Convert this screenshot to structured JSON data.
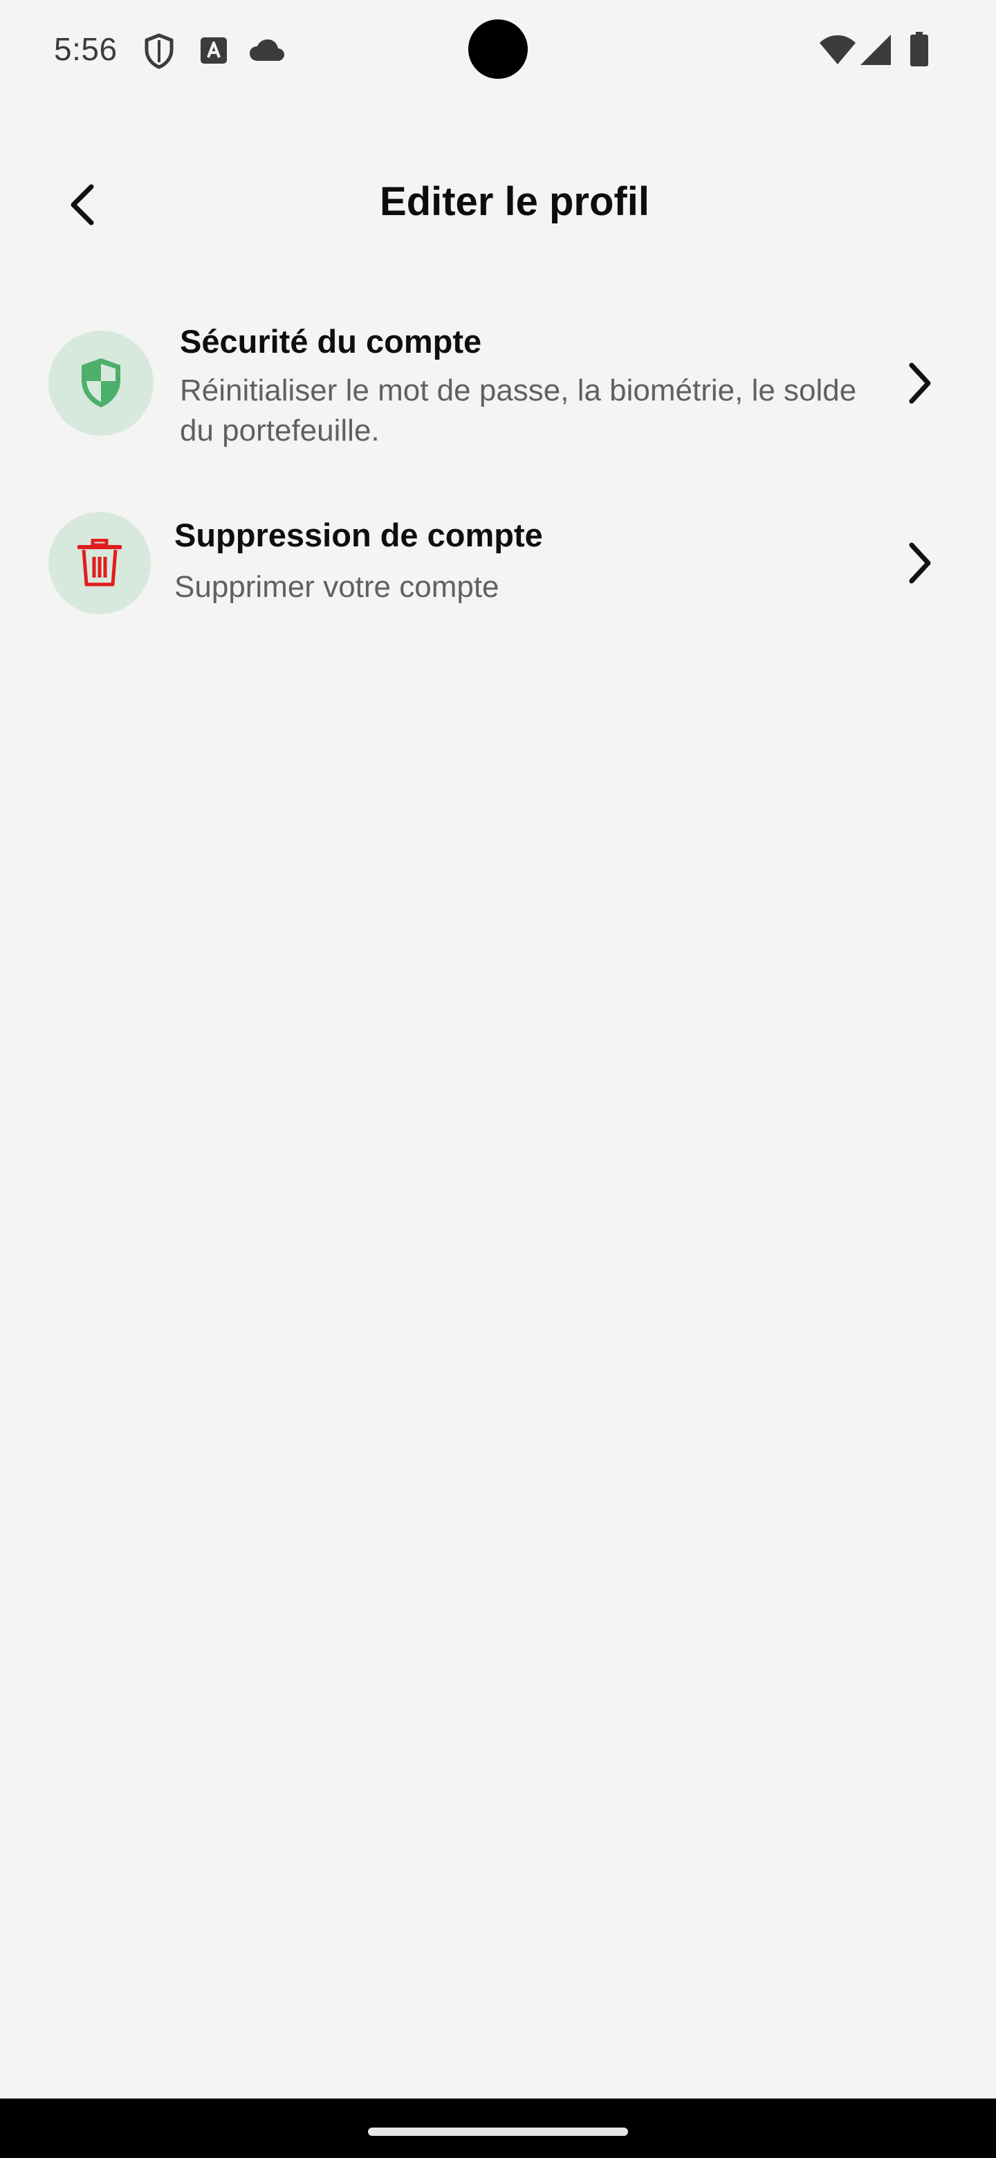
{
  "status_bar": {
    "time": "5:56",
    "left_icons": [
      "shield-icon",
      "font-download-icon",
      "cloud-icon"
    ],
    "right_icons": [
      "wifi-icon",
      "cell-signal-icon",
      "battery-icon"
    ]
  },
  "header": {
    "title": "Editer le profil",
    "back_icon": "chevron-left-icon"
  },
  "menu": {
    "items": [
      {
        "title": "Sécurité du compte",
        "subtitle": "Réinitialiser le mot de passe, la biométrie, le solde du portefeuille.",
        "icon": "security-shield-icon",
        "icon_color": "#4caf6a"
      },
      {
        "title": "Suppression de compte",
        "subtitle": "Supprimer votre compte",
        "icon": "trash-icon",
        "icon_color": "#e21d1d"
      }
    ]
  },
  "colors": {
    "background": "#f4f4f4",
    "icon_circle": "#d7e9dc",
    "subtitle_text": "#5f6161",
    "nav_bar": "#000000"
  }
}
